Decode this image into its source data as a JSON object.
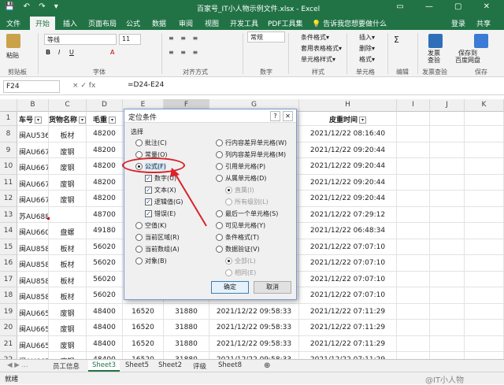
{
  "window": {
    "title": "百家号_IT小人物示例文件.xlsx - Excel",
    "login": "登录",
    "share": "共享",
    "quick_access": "💾 ↶ ↷ ▾",
    "window_controls": "▭ — ▢ ✕"
  },
  "ribbon_tabs": [
    "文件",
    "开始",
    "插入",
    "页面布局",
    "公式",
    "数据",
    "审阅",
    "视图",
    "开发工具",
    "PDF工具集",
    "💡 告诉我您想要做什么"
  ],
  "ribbon": {
    "paste": "粘贴",
    "clipboard": "剪贴板",
    "font_name": "等线",
    "font_size": "11",
    "font_group": "字体",
    "align_group": "对齐方式",
    "number_format": "常规",
    "number_group": "数字",
    "styles": [
      "条件格式▾",
      "套用表格格式▾",
      "单元格样式▾"
    ],
    "styles_group": "样式",
    "cells": [
      "插入▾",
      "删除▾",
      "格式▾"
    ],
    "cells_group": "单元格",
    "edit_group": "编辑",
    "invoice": "发票\n查验",
    "invoice_group": "发票查验",
    "baidu": "保存到\n百度网盘",
    "save_group": "保存"
  },
  "formula_bar": {
    "name_box": "F24",
    "fx": "×  ✓  fx",
    "formula": "=D24-E24"
  },
  "columns": [
    "B",
    "C",
    "D",
    "E",
    "F",
    "G",
    "H",
    "I",
    "J",
    "K"
  ],
  "header_row": {
    "num": "1",
    "b": "车号",
    "c": "货物名称",
    "d": "毛重",
    "h": "皮重时间"
  },
  "rows": [
    {
      "num": "8",
      "b": "闽AU536",
      "c": "板材",
      "d": "48200",
      "e": "",
      "f": "",
      "g": "",
      "h": "2021/12/22 08:16:40"
    },
    {
      "num": "9",
      "b": "闽AU667",
      "c": "废钢",
      "d": "48200",
      "e": "",
      "f": "",
      "g": "",
      "h": "2021/12/22 09:20:44"
    },
    {
      "num": "10",
      "b": "闽AU667",
      "c": "废钢",
      "d": "48200",
      "e": "",
      "f": "",
      "g": "",
      "h": "2021/12/22 09:20:44"
    },
    {
      "num": "11",
      "b": "闽AU667",
      "c": "废钢",
      "d": "48200",
      "e": "",
      "f": "",
      "g": "",
      "h": "2021/12/22 09:20:44"
    },
    {
      "num": "12",
      "b": "闽AU667",
      "c": "废钢",
      "d": "48200",
      "e": "",
      "f": "",
      "g": "",
      "h": "2021/12/22 09:20:44"
    },
    {
      "num": "13",
      "b": "苏AU688",
      "c": "",
      "d": "48700",
      "e": "",
      "f": "",
      "g": "",
      "h": "2021/12/22 07:29:12"
    },
    {
      "num": "14",
      "b": "闽AU660",
      "c": "盘螺",
      "d": "49180",
      "e": "",
      "f": "",
      "g": "",
      "h": "2021/12/22 06:48:34"
    },
    {
      "num": "15",
      "b": "闽AU858",
      "c": "板材",
      "d": "56020",
      "e": "",
      "f": "",
      "g": "",
      "h": "2021/12/22 07:07:10"
    },
    {
      "num": "16",
      "b": "闽AU858",
      "c": "板材",
      "d": "56020",
      "e": "",
      "f": "",
      "g": "",
      "h": "2021/12/22 07:07:10"
    },
    {
      "num": "17",
      "b": "闽AU858",
      "c": "板材",
      "d": "56020",
      "e": "",
      "f": "",
      "g": "",
      "h": "2021/12/22 07:07:10"
    },
    {
      "num": "18",
      "b": "闽AU858",
      "c": "板材",
      "d": "56020",
      "e": "",
      "f": "",
      "g": "",
      "h": "2021/12/22 07:07:10"
    },
    {
      "num": "19",
      "b": "闽AU665",
      "c": "废钢",
      "d": "48400",
      "e": "16520",
      "f": "31880",
      "g": "2021/12/22 09:58:33",
      "h": "2021/12/22 07:11:29"
    },
    {
      "num": "20",
      "b": "闽AU665",
      "c": "废钢",
      "d": "48400",
      "e": "16520",
      "f": "31880",
      "g": "2021/12/22 09:58:33",
      "h": "2021/12/22 07:11:29"
    },
    {
      "num": "21",
      "b": "闽AU665",
      "c": "废钢",
      "d": "48400",
      "e": "16520",
      "f": "31880",
      "g": "2021/12/22 09:58:33",
      "h": "2021/12/22 07:11:29"
    },
    {
      "num": "22",
      "b": "闽AU665",
      "c": "废钢",
      "d": "48400",
      "e": "16520",
      "f": "31880",
      "g": "2021/12/22 09:58:33",
      "h": "2021/12/22 07:11:29"
    }
  ],
  "dialog": {
    "title": "定位条件",
    "help": "?",
    "close": "✕",
    "section": "选择",
    "left": [
      "批注(C)",
      "常量(O)",
      "公式(F)",
      "数字(U)",
      "文本(X)",
      "逻辑值(G)",
      "错误(E)",
      "空值(K)",
      "当前区域(R)",
      "当前数组(A)",
      "对象(B)"
    ],
    "right": [
      "行内容差异单元格(W)",
      "列内容差异单元格(M)",
      "引用单元格(P)",
      "从属单元格(D)",
      "直属(I)",
      "所有级别(L)",
      "最后一个单元格(S)",
      "可见单元格(Y)",
      "条件格式(T)",
      "数据验证(V)",
      "全部(L)",
      "相同(E)"
    ],
    "ok": "确定",
    "cancel": "取消"
  },
  "sheet_tabs": [
    "员工信息",
    "Sheet3",
    "Sheet5",
    "Sheet2",
    "评级",
    "Sheet8"
  ],
  "sheet_nav": "◀ ▶  ...",
  "add_sheet": "⊕",
  "status": {
    "ready": "就绪",
    "watermark": "@IT小人物"
  },
  "colors": {
    "accent": "#217346",
    "highlight": "#d9232a"
  }
}
